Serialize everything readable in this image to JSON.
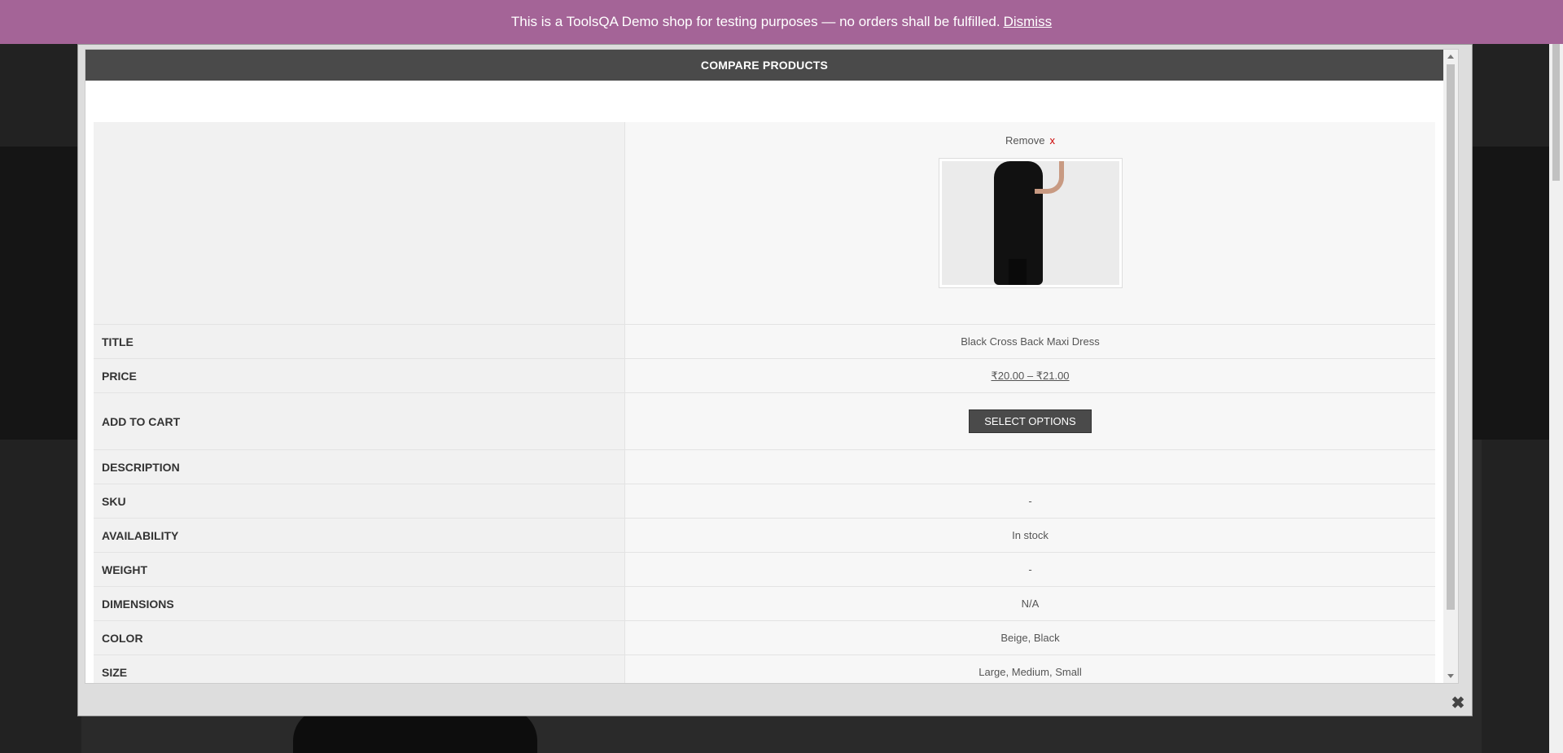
{
  "notice": {
    "text": "This is a ToolsQA Demo shop for testing purposes — no orders shall be fulfilled.",
    "dismiss": "Dismiss"
  },
  "modal": {
    "title": "COMPARE PRODUCTS",
    "remove_label": "Remove",
    "remove_x": "x",
    "rows": [
      {
        "label": "TITLE",
        "value": "Black Cross Back Maxi Dress"
      },
      {
        "label": "PRICE",
        "value": "₹20.00 – ₹21.00"
      },
      {
        "label": "ADD TO CART",
        "value": "SELECT OPTIONS"
      },
      {
        "label": "DESCRIPTION",
        "value": ""
      },
      {
        "label": "SKU",
        "value": "-"
      },
      {
        "label": "AVAILABILITY",
        "value": "In stock"
      },
      {
        "label": "WEIGHT",
        "value": "-"
      },
      {
        "label": "DIMENSIONS",
        "value": "N/A"
      },
      {
        "label": "COLOR",
        "value": "Beige, Black"
      },
      {
        "label": "SIZE",
        "value": "Large, Medium, Small"
      }
    ],
    "close": "✖"
  },
  "colors": {
    "notice_bg": "#a46497",
    "title_bar": "#4a4a4a",
    "in_stock": "#2b9a2b",
    "remove_x": "#cc0000"
  }
}
